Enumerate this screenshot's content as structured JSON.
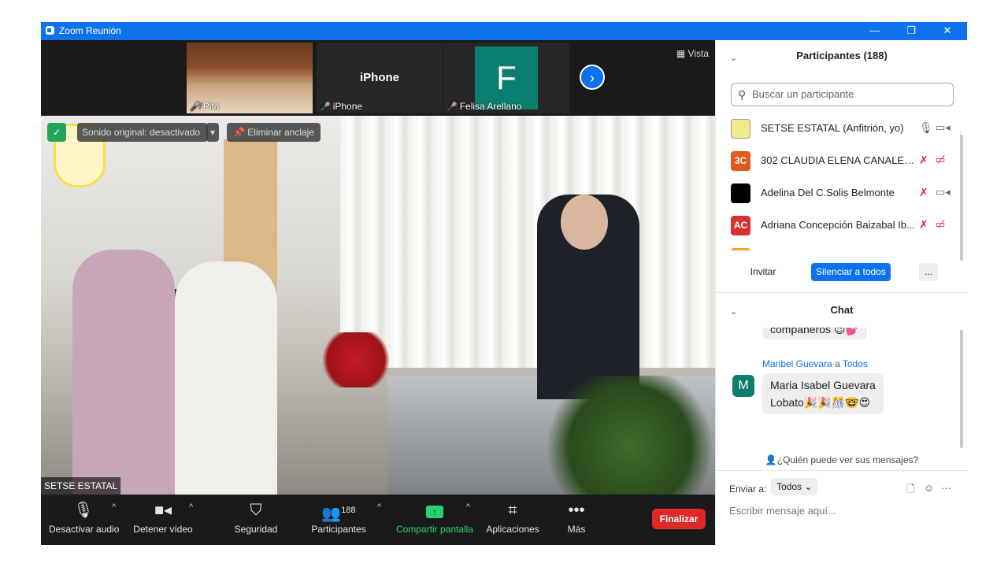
{
  "window": {
    "title": "Zoom Reunión"
  },
  "window_controls": {
    "minimize": "—",
    "restore": "❐",
    "close": "✕"
  },
  "thumbnails": [
    {
      "name": "Pita"
    },
    {
      "name": "iPhone",
      "display": "iPhone"
    },
    {
      "name": "Felisa Arellano",
      "initial": "F"
    }
  ],
  "view_button": "Vista",
  "main_video": {
    "audio_status": "Sonido original: desactivado",
    "unpin": "Eliminar anclaje",
    "speaker_name": "SETSE ESTATAL"
  },
  "toolbar": {
    "mute": "Desactivar audio",
    "stop_video": "Detener vídeo",
    "security": "Seguridad",
    "participants": "Participantes",
    "participants_count": "188",
    "share": "Compartir pantalla",
    "apps": "Aplicaciones",
    "more": "Más",
    "end": "Finalizar"
  },
  "participants_panel": {
    "title": "Participantes (188)",
    "search_placeholder": "Buscar un participante",
    "list": [
      {
        "name": "SETSE ESTATAL (Anfitrión, yo)",
        "avatar": "",
        "color": "#ffffff"
      },
      {
        "name": "302 CLAUDIA ELENA CANALES ...",
        "avatar": "3C",
        "color": "#e05a1b"
      },
      {
        "name": "Adelina Del C.Solis Belmonte",
        "avatar": "",
        "color": "#000000"
      },
      {
        "name": "Adriana Concepción Baizabal Ib...",
        "avatar": "AC",
        "color": "#d8322f"
      }
    ],
    "invite": "Invitar",
    "mute_all": "Silenciar a todos",
    "more": "..."
  },
  "chat": {
    "title": "Chat",
    "prev_message": "compañeros 😉💕",
    "messages": [
      {
        "sender": "Maribel Guevara",
        "to_label": "a",
        "to": "Todos",
        "avatar": "M",
        "line1": "Maria Isabel Guevara",
        "line2": "Lobato🎉🎉🎊🤓😍"
      }
    ],
    "who_can_see": "¿Quién puede ver sus mensajes?",
    "send_to_label": "Enviar a:",
    "send_to_value": "Todos",
    "placeholder": "Escribir mensaje aquí..."
  }
}
